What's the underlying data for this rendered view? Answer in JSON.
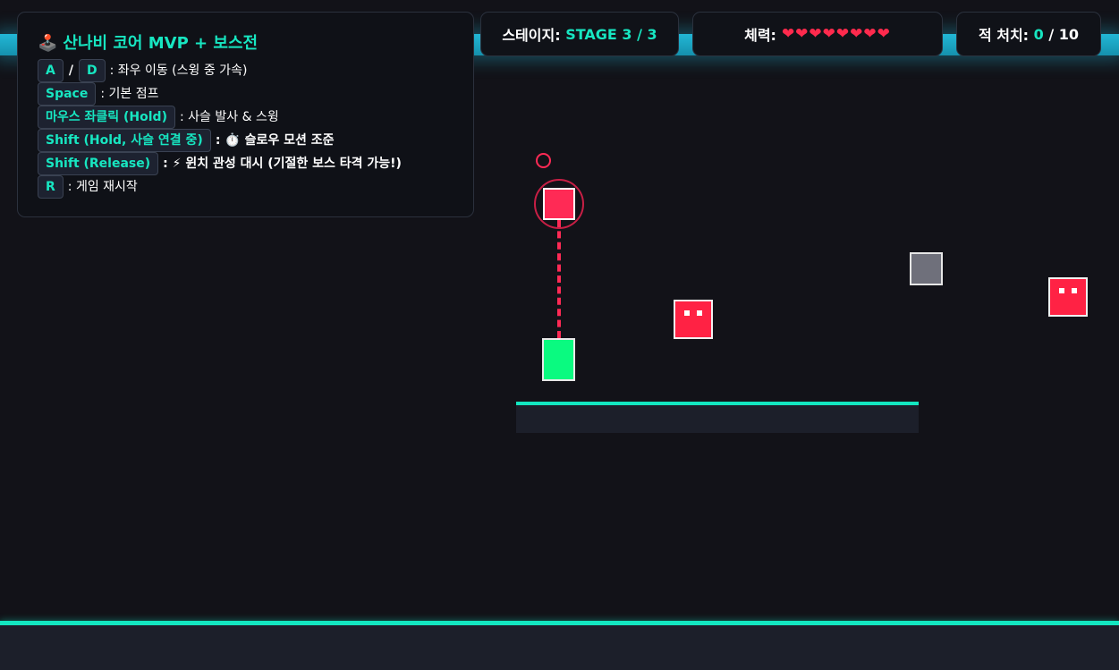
{
  "hud": {
    "stage_label": "스테이지:",
    "stage_value": "STAGE 3 / 3",
    "health_label": "체력:",
    "health_hearts": "❤❤❤❤❤❤❤❤",
    "kills_label": "적 처치:",
    "kills_current": "0",
    "kills_total": "/ 10"
  },
  "help": {
    "title_icon": "🕹️",
    "title": "산나비 코어 MVP + 보스전",
    "rows": [
      {
        "keys": [
          "A",
          "D"
        ],
        "sep": "/",
        "desc": ": 좌우 이동 (스윙 중 가속)"
      },
      {
        "keys": [
          "Space"
        ],
        "desc": ": 기본 점프"
      },
      {
        "keys": [
          "마우스 좌클릭 (Hold)"
        ],
        "desc": ": 사슬 발사 & 스윙"
      },
      {
        "keys": [
          "Shift (Hold, 사슬 연결 중)"
        ],
        "desc": ": ⏱️ 슬로우 모션 조준"
      },
      {
        "keys": [
          "Shift (Release)"
        ],
        "desc": ": ⚡ 윈치 관성 대시 (기절한 보스 타격 가능!)"
      },
      {
        "keys": [
          "R"
        ],
        "desc": ": 게임 재시작"
      }
    ]
  },
  "colors": {
    "accent": "#17e6c1",
    "enemy": "#ff2244",
    "player": "#0afa80",
    "rope": "#ff2a55",
    "top_glow": "#22b7d6"
  }
}
